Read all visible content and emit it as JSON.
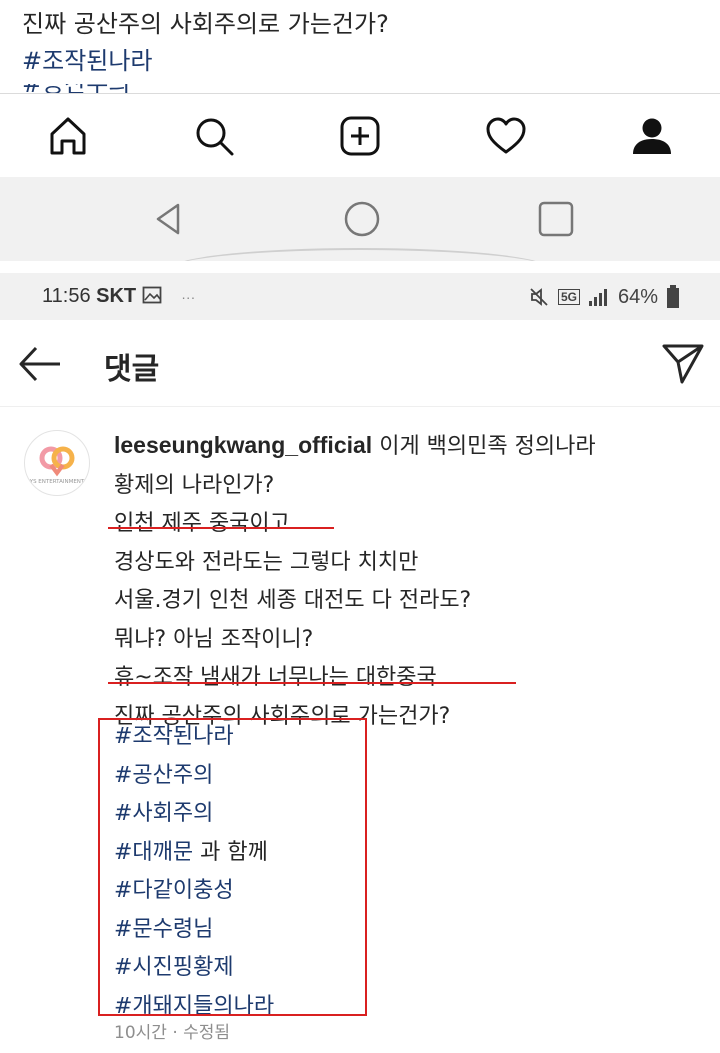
{
  "top_screenshot": {
    "text_line": "진짜 공산주의 사회주의로 가는건가?",
    "hashtag": "#조작된나라",
    "cut_hashtag": "#공산주의",
    "nav_icons": [
      "home-icon",
      "search-icon",
      "add-post-icon",
      "heart-icon",
      "profile-icon"
    ],
    "system_buttons": [
      "back-triangle-icon",
      "home-circle-icon",
      "recent-square-icon"
    ]
  },
  "status_bar": {
    "time": "11:56",
    "carrier": "SKT",
    "network": "5G",
    "battery": "64%",
    "dots": "···"
  },
  "header": {
    "title": "댓글"
  },
  "comment": {
    "username": "leeseungkwang_official",
    "lines": [
      "이게 백의민족 정의나라",
      "황제의 나라인가?",
      "인천 제주 중국이고",
      "경상도와 전라도는 그렇다 치치만",
      "서울.경기 인천 세종 대전도 다 전라도?",
      "뭐냐? 아님 조작이니?",
      "휴~조작 냄새가 너무나는 대한중국",
      "진짜 공산주의 사회주의로 가는건가?"
    ],
    "hashtags": [
      "#조작된나라",
      "#공산주의",
      "#사회주의",
      "#대깨문",
      "#다같이충성",
      "#문수령님",
      "#시진핑황제",
      "#개돼지들의나라"
    ],
    "hashtag_suffix": " 과 함께",
    "meta": "10시간 · 수정됨",
    "avatar_label": "YS ENTERTAINMENT"
  },
  "colors": {
    "hashtag": "#1d3a6e",
    "highlight_red": "#d92020",
    "system_bar": "#f1f1f1"
  }
}
